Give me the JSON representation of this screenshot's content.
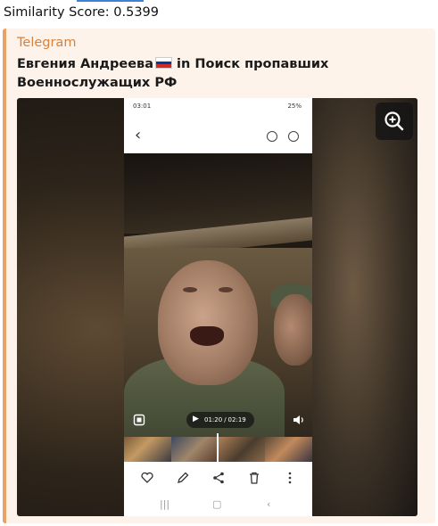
{
  "header": {
    "similarity_label": "Similarity Score: 0.5399"
  },
  "post": {
    "source": "Telegram",
    "title_prefix": "Евгения Андреева",
    "title_suffix": " in Поиск пропавших Военнослужащих РФ",
    "flag_colors": [
      "#ffffff",
      "#0039a6",
      "#d52b1e"
    ],
    "accent_color": "#e9a266",
    "source_color": "#d9823b",
    "background_color": "#fdf3ea"
  },
  "media": {
    "zoom_icon": "zoom-in-icon",
    "phone": {
      "status_time": "03:01",
      "status_battery": "25%",
      "player": {
        "current_time": "01:20",
        "separator": "/",
        "total_time": "02:19"
      },
      "action_icons": [
        "heart-icon",
        "edit-icon",
        "share-icon",
        "trash-icon",
        "more-icon"
      ],
      "nav_icons": [
        "recents-icon",
        "home-icon",
        "back-icon"
      ]
    }
  }
}
